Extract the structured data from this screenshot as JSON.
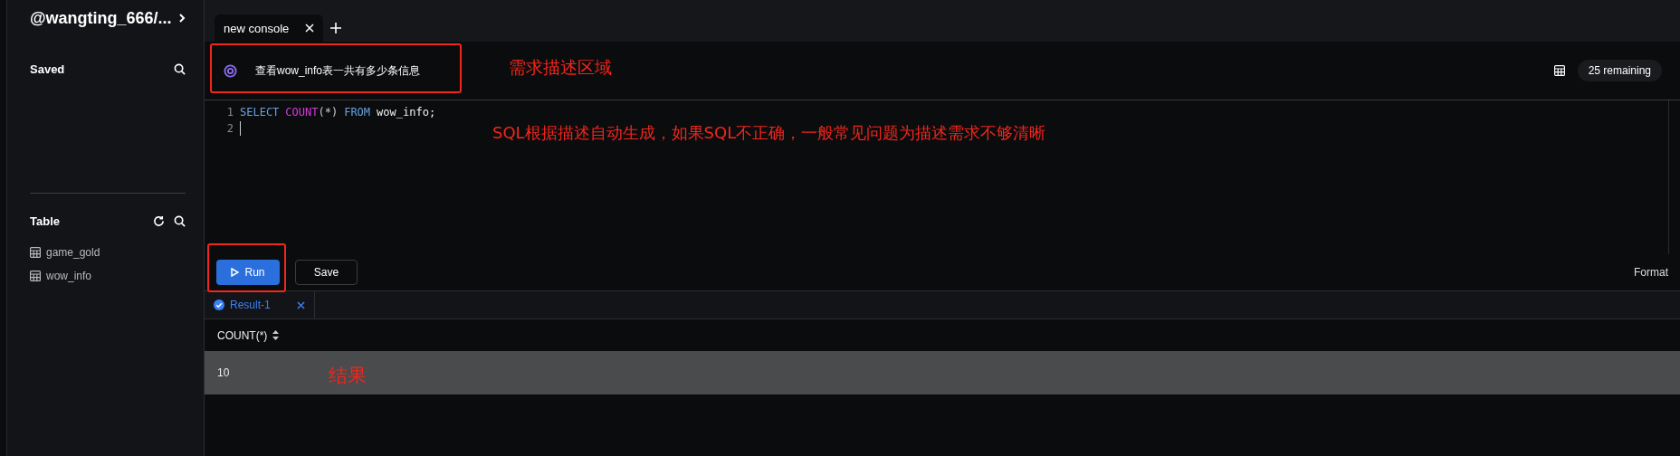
{
  "sidebar": {
    "title": "@wangting_666/...",
    "saved": {
      "heading": "Saved"
    },
    "table": {
      "heading": "Table",
      "items": [
        {
          "label": "game_gold"
        },
        {
          "label": "wow_info"
        }
      ]
    }
  },
  "tabs": [
    {
      "label": "new console",
      "selected": true
    }
  ],
  "prompt": {
    "text": "查看wow_info表一共有多少条信息",
    "remaining": "25 remaining",
    "highlighted": true,
    "note": "需求描述区域"
  },
  "editor": {
    "note": "SQL根据描述自动生成，如果SQL不正确，一般常见问题为描述需求不够清晰",
    "lines": [
      {
        "number": "1",
        "tokens": [
          {
            "kind": "keyword",
            "text": "SELECT"
          },
          {
            "kind": "function",
            "text": "COUNT"
          },
          {
            "kind": "punct",
            "text": "(*)"
          },
          {
            "kind": "keyword",
            "text": "FROM"
          },
          {
            "kind": "plain",
            "text": "wow_info;"
          }
        ]
      },
      {
        "number": "2"
      }
    ]
  },
  "actions": {
    "run": "Run",
    "run_highlighted": true,
    "save": "Save",
    "format": "Format"
  },
  "results": {
    "tabs": [
      {
        "label": "Result-1",
        "selected": true
      }
    ],
    "columns": [
      "COUNT(*)"
    ],
    "rows": [
      [
        "10"
      ]
    ],
    "note": "结果"
  }
}
